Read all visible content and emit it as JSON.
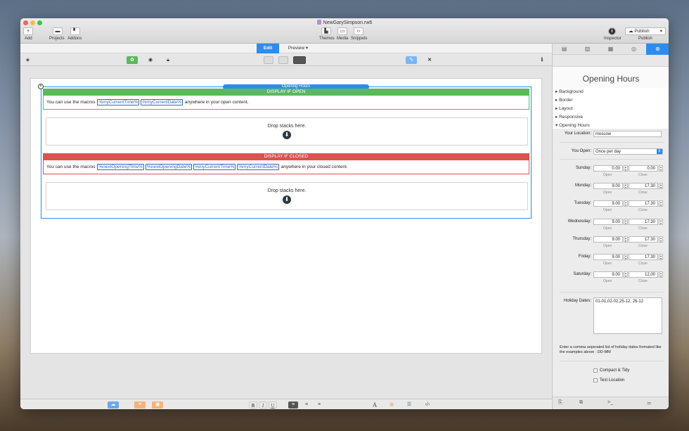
{
  "window": {
    "title": "NewGarySimpson.rw6"
  },
  "toolbar": {
    "add_label": "Add",
    "projects_label": "Projects",
    "addons_label": "Addons",
    "themes_label": "Themes",
    "media_label": "Media",
    "snippets_label": "Snippets",
    "inspector_label": "Inspector",
    "publish_label": "Publish",
    "publish_button": "Publish"
  },
  "modes": {
    "edit": "Edit",
    "preview": "Preview"
  },
  "stack": {
    "name": "Opening Hours",
    "open_header": "DISPLAY IF OPEN",
    "open_text_before": "You can use the macros",
    "open_macros": [
      "%myCurrentTime%",
      "%myCurrentDate%"
    ],
    "open_text_after": "anywhere in your open content.",
    "closed_header": "DISPLAY IF CLOSED",
    "closed_text_before": "You can use the macros",
    "closed_macros": [
      "%nextOpeningTime%",
      "%nextOpeningDate%",
      "%myCurrentTime%",
      "%myCurrentDate%"
    ],
    "closed_text_after": "anywhere in your closed content.",
    "drop_text": "Drop stacks here.",
    "open_color": "#5cb85c",
    "closed_color": "#d9534f"
  },
  "inspector": {
    "title": "Opening Hours",
    "sections": [
      "Background",
      "Border",
      "Layout",
      "Responsive",
      "Opening Hours"
    ],
    "location_label": "Your Location:",
    "location_value": "moscow",
    "you_open_label": "You Open:",
    "you_open_value": "Once per day",
    "open_sub": "Open",
    "close_sub": "Close",
    "days": [
      {
        "label": "Sunday:",
        "open": "0.00",
        "close": "0.00"
      },
      {
        "label": "Monday:",
        "open": "9.00",
        "close": "17.30"
      },
      {
        "label": "Tuesday:",
        "open": "9.00",
        "close": "17.30"
      },
      {
        "label": "Wednesday:",
        "open": "9.00",
        "close": "17.30"
      },
      {
        "label": "Thursday:",
        "open": "9.00",
        "close": "17.30"
      },
      {
        "label": "Friday:",
        "open": "9.00",
        "close": "17.30"
      },
      {
        "label": "Saturday:",
        "open": "9.00",
        "close": "12.00"
      }
    ],
    "holiday_label": "Holiday Dates:",
    "holiday_value": "01-01,02-02,25-12, 26-12",
    "holiday_help": "Enter a comma seperated list of holiday dates formated like the examples above : DD-MM",
    "compact_label": "Compact & Tidy",
    "test_location_label": "Test Location"
  },
  "colors": {
    "accent": "#2d8cf0",
    "ok": "#5cb85c",
    "danger": "#d9534f"
  }
}
